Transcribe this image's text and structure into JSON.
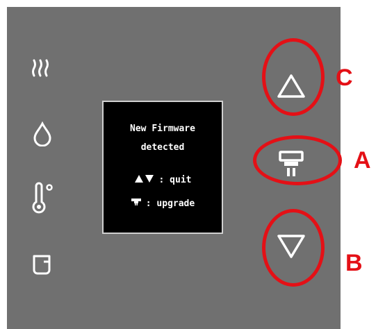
{
  "side_icons": [
    "steam-icon",
    "water-drop-icon",
    "thermometer-icon",
    "cup-icon"
  ],
  "screen": {
    "line1": "New Firmware",
    "line2": "detected",
    "quit_label": ": quit",
    "upgrade_label": ": upgrade"
  },
  "buttons": {
    "up": "up-triangle-icon",
    "dispense": "dispense-icon",
    "down": "down-triangle-icon"
  },
  "callouts": {
    "c": "C",
    "a": "A",
    "b": "B"
  },
  "colors": {
    "panel": "#707070",
    "highlight": "#e41016",
    "icon": "#ffffff",
    "screen": "#000000"
  }
}
